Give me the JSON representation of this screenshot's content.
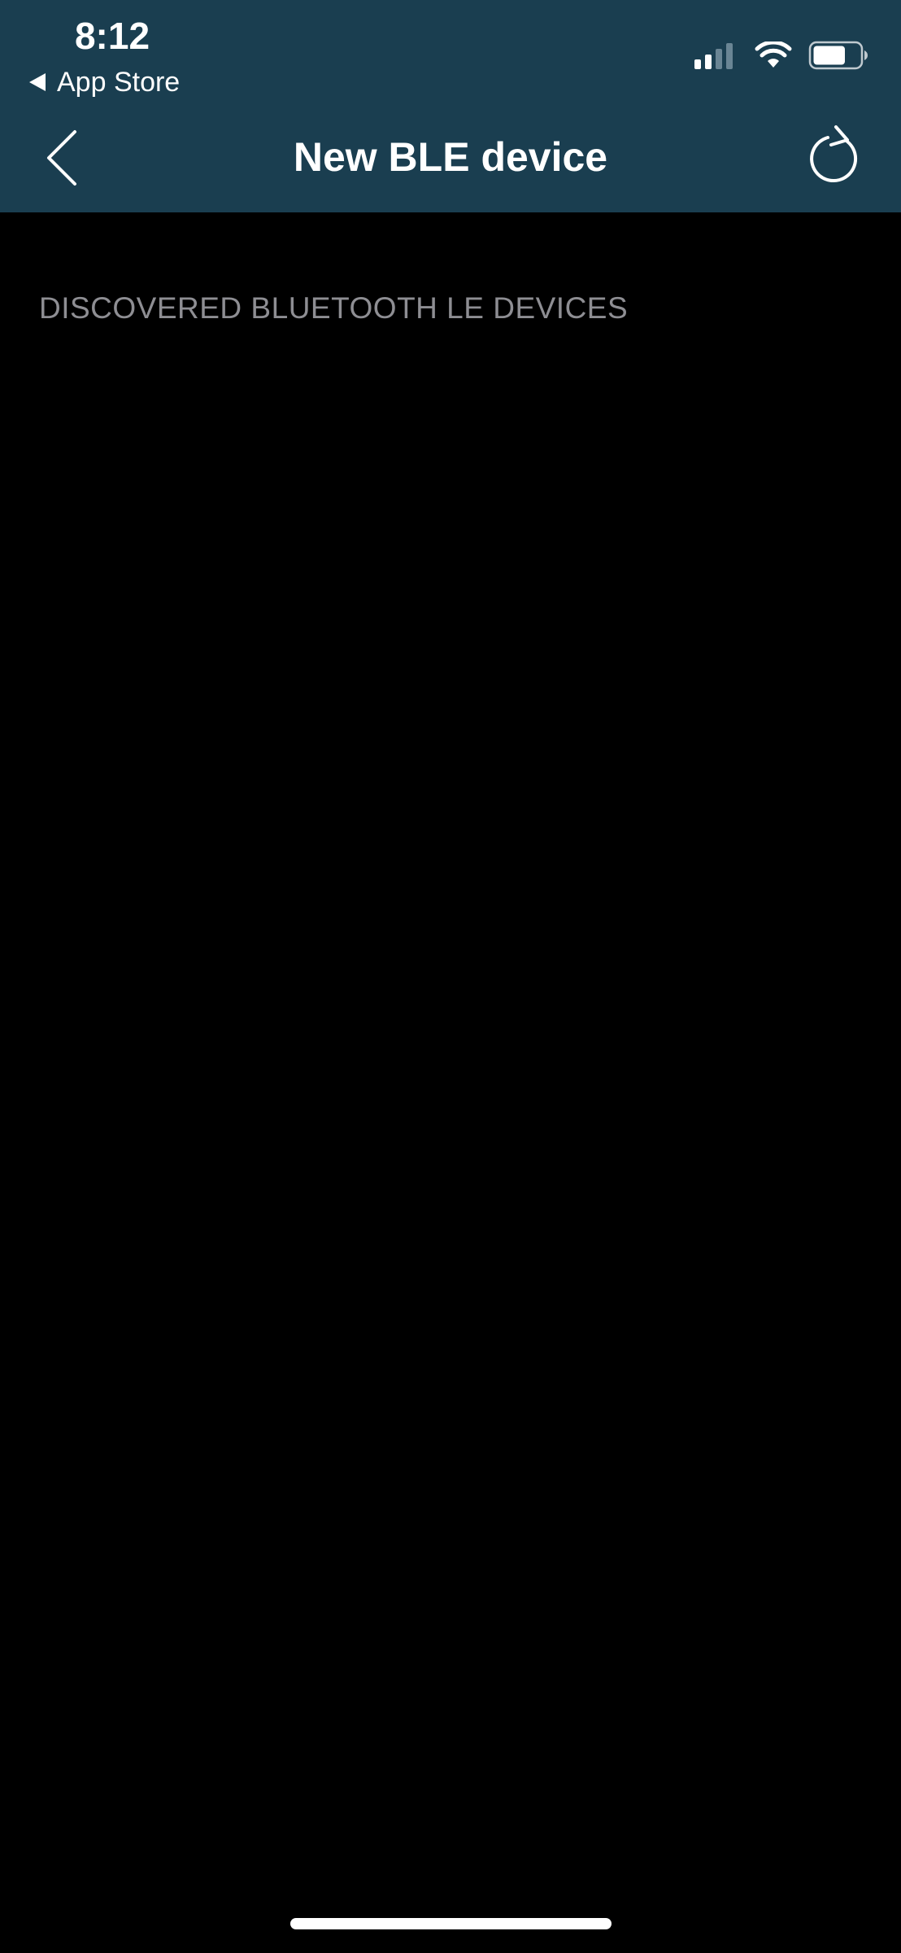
{
  "status_bar": {
    "time": "8:12",
    "back_app_label": "App Store",
    "signal_bars_active": 2,
    "signal_bars_total": 4,
    "battery_level": 0.7
  },
  "nav_bar": {
    "title": "New BLE device",
    "back_icon": "chevron-left-icon",
    "refresh_icon": "refresh-icon"
  },
  "content": {
    "section_header": "DISCOVERED BLUETOOTH LE DEVICES",
    "devices": []
  },
  "colors": {
    "nav_background": "#1a3e50",
    "page_background": "#000000",
    "section_header_text": "#8e8e93"
  }
}
